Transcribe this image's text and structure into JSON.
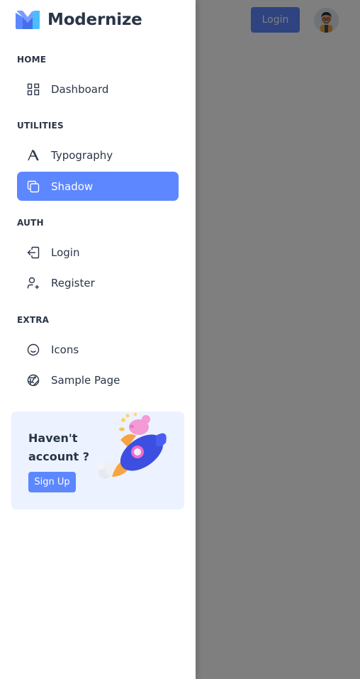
{
  "header": {
    "login_label": "Login"
  },
  "brand": {
    "name": "Modernize"
  },
  "sidebar": {
    "sections": [
      {
        "title": "HOME",
        "items": [
          {
            "label": "Dashboard",
            "icon": "dashboard-icon",
            "active": false
          }
        ]
      },
      {
        "title": "UTILITIES",
        "items": [
          {
            "label": "Typography",
            "icon": "typography-icon",
            "active": false
          },
          {
            "label": "Shadow",
            "icon": "copy-icon",
            "active": true
          }
        ]
      },
      {
        "title": "AUTH",
        "items": [
          {
            "label": "Login",
            "icon": "login-icon",
            "active": false
          },
          {
            "label": "Register",
            "icon": "user-plus-icon",
            "active": false
          }
        ]
      },
      {
        "title": "EXTRA",
        "items": [
          {
            "label": "Icons",
            "icon": "mood-smile-icon",
            "active": false
          },
          {
            "label": "Sample Page",
            "icon": "aperture-icon",
            "active": false
          }
        ]
      }
    ]
  },
  "promo": {
    "text": "Haven't account ?",
    "button_label": "Sign Up"
  },
  "colors": {
    "primary": "#5d87ff",
    "text": "#2a3547",
    "promo_bg": "#ecf2ff",
    "overlay": "rgba(0,0,0,0.5)"
  }
}
